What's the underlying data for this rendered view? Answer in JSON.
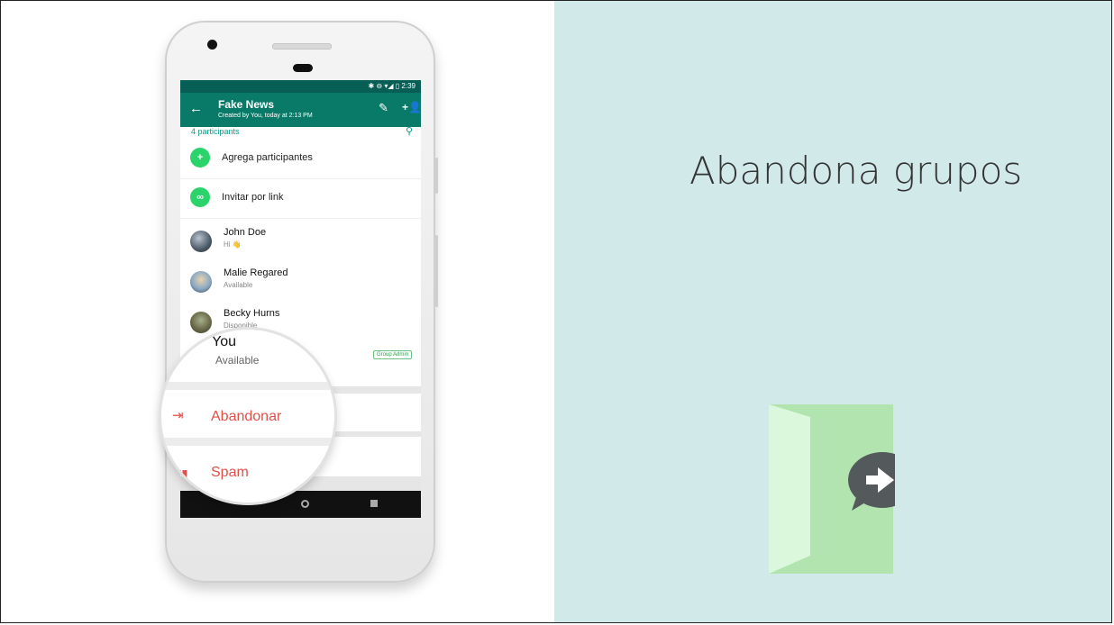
{
  "slide": {
    "heading": "Abandona grupos"
  },
  "phone": {
    "status_time": "2:39",
    "group_title": "Fake News",
    "group_subtitle": "Created by You, today at 2:13 PM",
    "participants_count": "4 participants",
    "actions": [
      {
        "label": "Agrega participantes",
        "icon": "add-person-icon"
      },
      {
        "label": "Invitar por link",
        "icon": "link-icon"
      }
    ],
    "contacts": [
      {
        "name": "John Doe",
        "status": "Hi 👋"
      },
      {
        "name": "Malie Regared",
        "status": "Available"
      },
      {
        "name": "Becky Hurns",
        "status": "Disponible"
      }
    ],
    "you": {
      "name": "You",
      "status": "Available",
      "badge": "Group Admin"
    },
    "leave_label": "Abandonar",
    "spam_label": "Spam"
  },
  "colors": {
    "whatsapp_dark": "#075e54",
    "whatsapp_header": "#0a7a68",
    "accent_green": "#2bd46a",
    "danger": "#e0504a",
    "right_panel": "#d2e9ea"
  }
}
